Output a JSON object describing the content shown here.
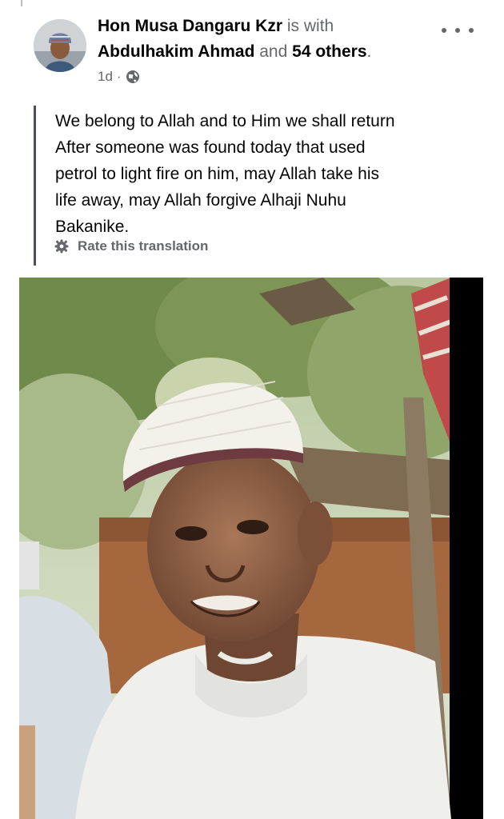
{
  "post": {
    "author": "Hon Musa Dangaru Kzr",
    "is_with": "is with",
    "tagged": "Abdulhakim Ahmad",
    "and": "and",
    "others": "54 others",
    "period": ".",
    "time": "1d",
    "separator": "·",
    "audience_icon": "globe-icon",
    "menu_icon": "more-options-icon"
  },
  "body": {
    "lines": [
      "We belong to Allah and to Him we shall return",
      "After someone was found today that used",
      "petrol to light fire on him, may Allah take his",
      "life away, may Allah forgive Alhaji Nuhu",
      "Bakanike."
    ],
    "rate_translation": "Rate this translation",
    "rate_icon": "gear-icon"
  },
  "colors": {
    "name_text": "#050505",
    "secondary_text": "#65676b",
    "quote_border": "#4b4f56"
  }
}
